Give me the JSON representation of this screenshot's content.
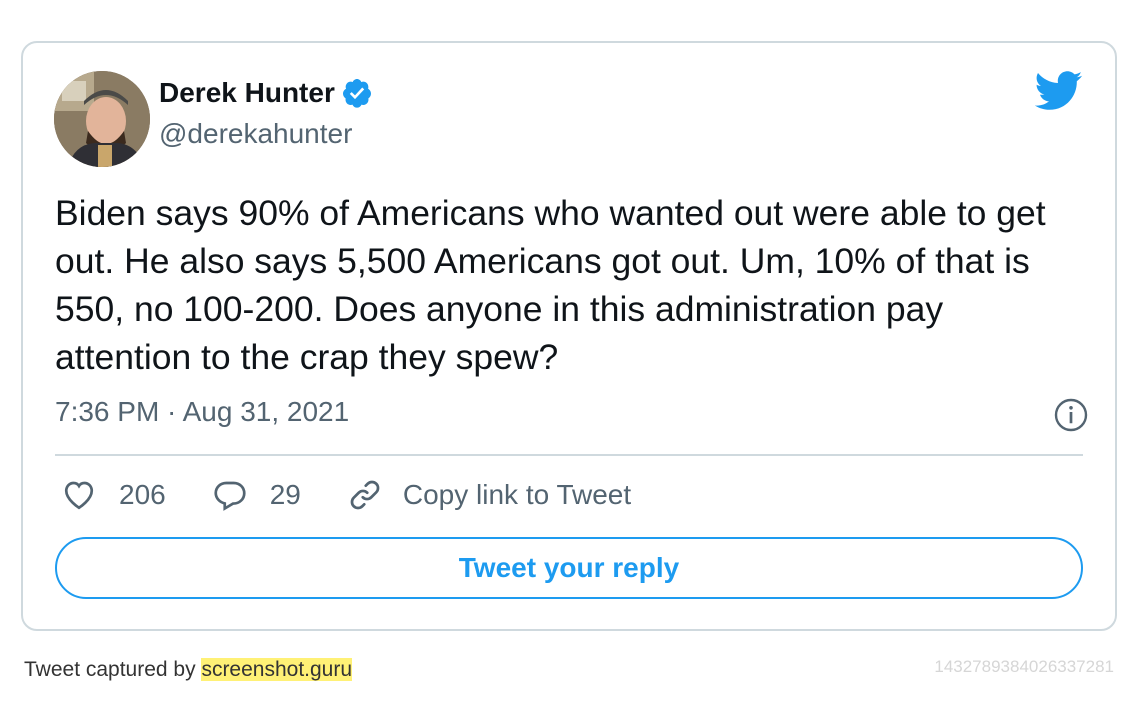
{
  "author": {
    "name": "Derek Hunter",
    "handle": "@derekahunter",
    "verified": true
  },
  "tweet": {
    "text": "Biden says 90% of Americans who wanted out were able to get out. He also says 5,500 Americans got out. Um, 10% of that is 550, no 100-200. Does anyone in this administration pay attention to the crap they spew?",
    "timestamp": "7:36 PM · Aug 31, 2021"
  },
  "actions": {
    "likes": "206",
    "replies": "29",
    "copy_link": "Copy link to Tweet"
  },
  "reply_button": "Tweet your reply",
  "footer": {
    "captured_by": "Tweet captured by ",
    "brand": "screenshot.guru",
    "tweet_id": "1432789384026337281"
  },
  "colors": {
    "accent": "#1d9bf0",
    "text": "#0f1419",
    "muted": "#536471",
    "border": "#cfd9de"
  },
  "icons": [
    "twitter-bird-icon",
    "verified-badge-icon",
    "info-icon",
    "heart-icon",
    "reply-bubble-icon",
    "link-icon"
  ]
}
